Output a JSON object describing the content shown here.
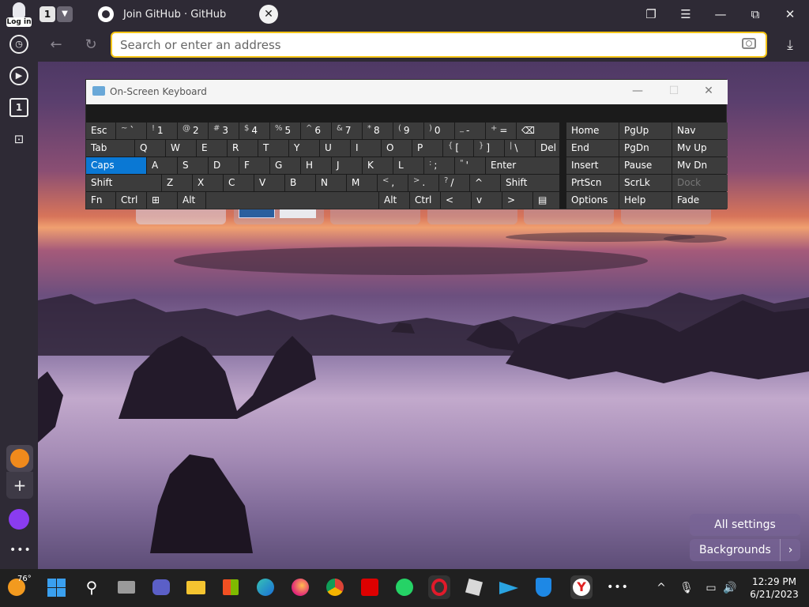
{
  "browser": {
    "login_label": "Log in",
    "tab_count": "1",
    "tab_title": "Join GitHub · GitHub",
    "address_placeholder": "Search or enter an address"
  },
  "sidebar": {
    "tabs_count": "1"
  },
  "osk": {
    "title": "On-Screen Keyboard",
    "rows": [
      [
        {
          "label": "Esc"
        },
        {
          "sub": "~",
          "label": "`"
        },
        {
          "sub": "!",
          "label": "1"
        },
        {
          "sub": "@",
          "label": "2"
        },
        {
          "sub": "#",
          "label": "3"
        },
        {
          "sub": "$",
          "label": "4"
        },
        {
          "sub": "%",
          "label": "5"
        },
        {
          "sub": "^",
          "label": "6"
        },
        {
          "sub": "&",
          "label": "7"
        },
        {
          "sub": "*",
          "label": "8"
        },
        {
          "sub": "(",
          "label": "9"
        },
        {
          "sub": ")",
          "label": "0"
        },
        {
          "sub": "_",
          "label": "-"
        },
        {
          "sub": "+",
          "label": "="
        },
        {
          "label": "⌫"
        }
      ],
      [
        {
          "label": "Tab"
        },
        {
          "label": "Q"
        },
        {
          "label": "W"
        },
        {
          "label": "E"
        },
        {
          "label": "R"
        },
        {
          "label": "T"
        },
        {
          "label": "Y"
        },
        {
          "label": "U"
        },
        {
          "label": "I"
        },
        {
          "label": "O"
        },
        {
          "label": "P"
        },
        {
          "sub": "{",
          "label": "["
        },
        {
          "sub": "}",
          "label": "]"
        },
        {
          "sub": "|",
          "label": "\\"
        },
        {
          "label": "Del"
        }
      ],
      [
        {
          "label": "Caps"
        },
        {
          "label": "A"
        },
        {
          "label": "S"
        },
        {
          "label": "D"
        },
        {
          "label": "F"
        },
        {
          "label": "G"
        },
        {
          "label": "H"
        },
        {
          "label": "J"
        },
        {
          "label": "K"
        },
        {
          "label": "L"
        },
        {
          "sub": ":",
          "label": ";"
        },
        {
          "sub": "\"",
          "label": "'"
        },
        {
          "label": "Enter"
        }
      ],
      [
        {
          "label": "Shift"
        },
        {
          "label": "Z"
        },
        {
          "label": "X"
        },
        {
          "label": "C"
        },
        {
          "label": "V"
        },
        {
          "label": "B"
        },
        {
          "label": "N"
        },
        {
          "label": "M"
        },
        {
          "sub": "<",
          "label": ","
        },
        {
          "sub": ">",
          "label": "."
        },
        {
          "sub": "?",
          "label": "/"
        },
        {
          "label": "^"
        },
        {
          "label": "Shift"
        }
      ],
      [
        {
          "label": "Fn"
        },
        {
          "label": "Ctrl"
        },
        {
          "label": "⊞"
        },
        {
          "label": "Alt"
        },
        {
          "label": ""
        },
        {
          "label": "Alt"
        },
        {
          "label": "Ctrl"
        },
        {
          "label": "<"
        },
        {
          "label": "v"
        },
        {
          "label": ">"
        },
        {
          "label": "▤"
        }
      ]
    ],
    "nav_rows": [
      [
        "Home",
        "PgUp",
        "Nav"
      ],
      [
        "End",
        "PgDn",
        "Mv Up"
      ],
      [
        "Insert",
        "Pause",
        "Mv Dn"
      ],
      [
        "PrtScn",
        "ScrLk",
        "Dock"
      ],
      [
        "Options",
        "Help",
        "Fade"
      ]
    ]
  },
  "newtab": {
    "all_settings": "All settings",
    "backgrounds": "Backgrounds"
  },
  "taskbar": {
    "weather_temp": "76°",
    "time": "12:29 PM",
    "date": "6/21/2023"
  },
  "colors": {
    "accent": "#f5c518",
    "caps_active": "#0a78d4"
  }
}
